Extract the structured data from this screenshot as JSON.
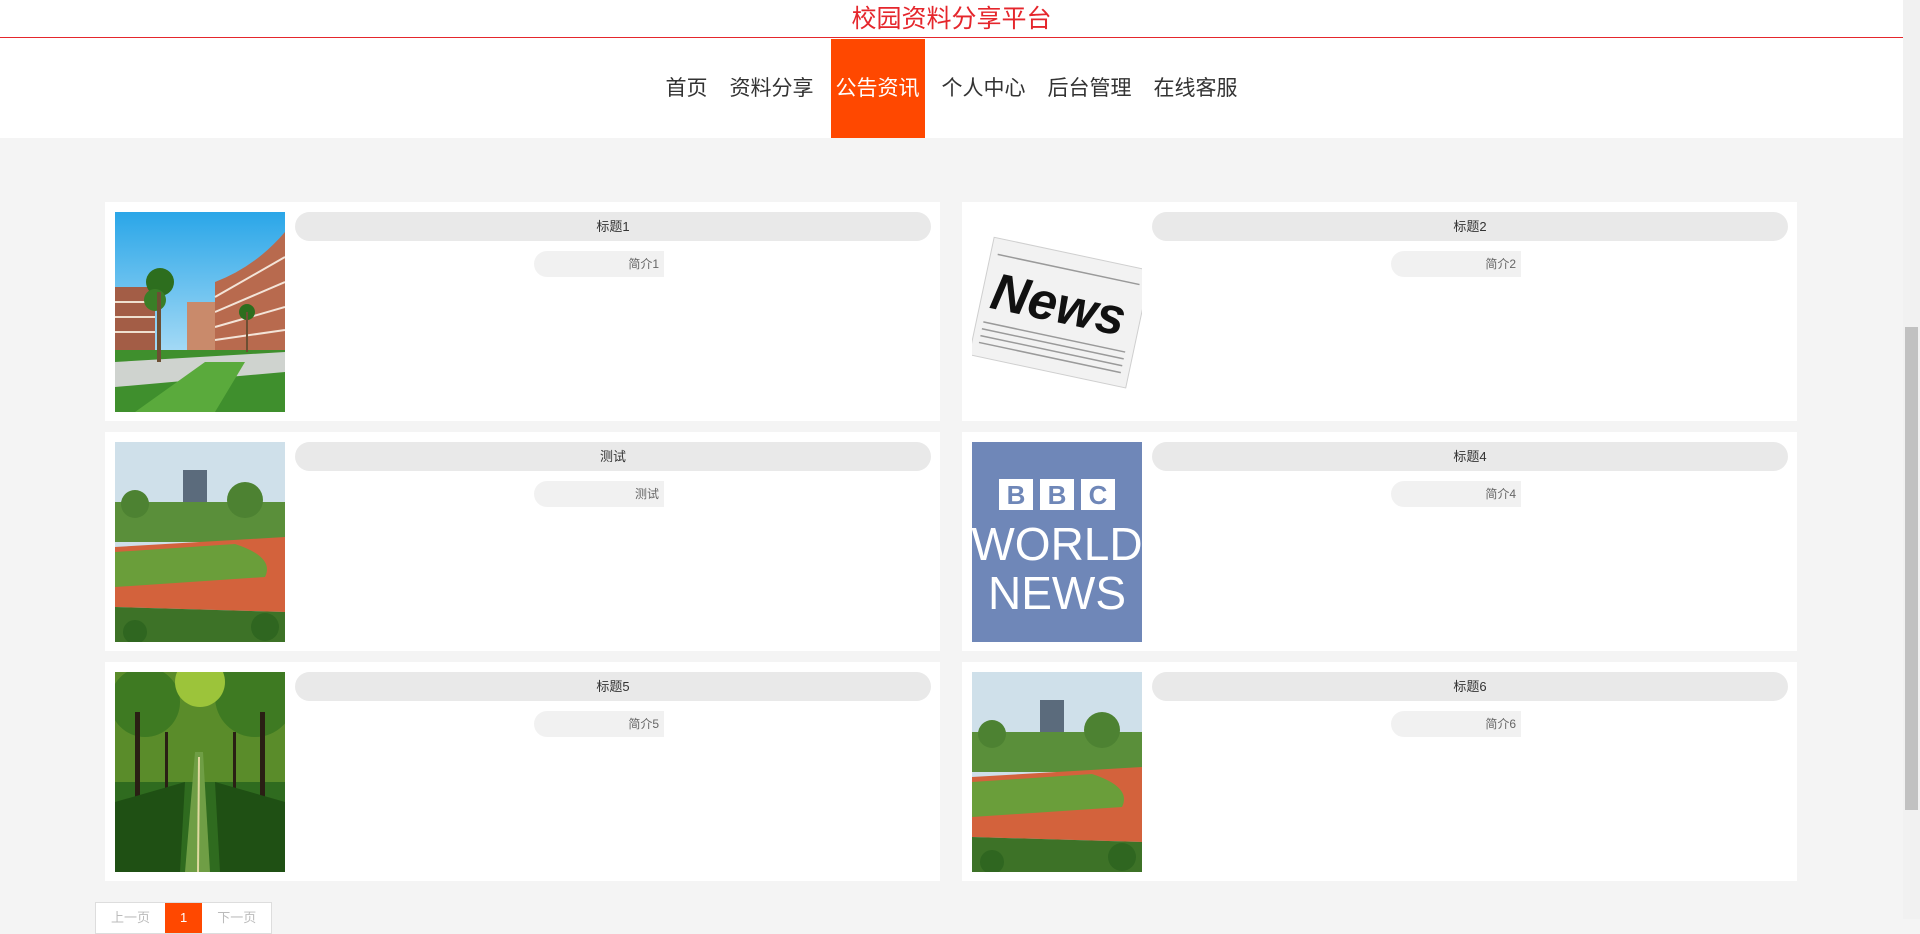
{
  "site": {
    "title": "校园资料分享平台"
  },
  "nav": {
    "items": [
      {
        "label": "首页"
      },
      {
        "label": "资料分享"
      },
      {
        "label": "公告资讯",
        "active": true
      },
      {
        "label": "个人中心"
      },
      {
        "label": "后台管理"
      },
      {
        "label": "在线客服"
      }
    ]
  },
  "news": [
    {
      "title": "标题1",
      "intro": "简介1",
      "image": "campus-building-image"
    },
    {
      "title": "标题2",
      "intro": "简介2",
      "image": "newspaper-news-image"
    },
    {
      "title": "测试",
      "intro": "测试",
      "image": "sports-field-image"
    },
    {
      "title": "标题4",
      "intro": "简介4",
      "image": "bbc-world-news-image"
    },
    {
      "title": "标题5",
      "intro": "简介5",
      "image": "tree-lined-path-image"
    },
    {
      "title": "标题6",
      "intro": "简介6",
      "image": "sports-field-image"
    }
  ],
  "pagination": {
    "prev": "上一页",
    "current": "1",
    "next": "下一页"
  },
  "bbc_logo": {
    "brand": "BBC",
    "line1": "WORLD",
    "line2": "NEWS"
  },
  "newspaper_logo": {
    "word": "News"
  },
  "colors": {
    "title_red": "#e5262c",
    "accent": "#ff4800",
    "background": "#f4f4f4"
  }
}
